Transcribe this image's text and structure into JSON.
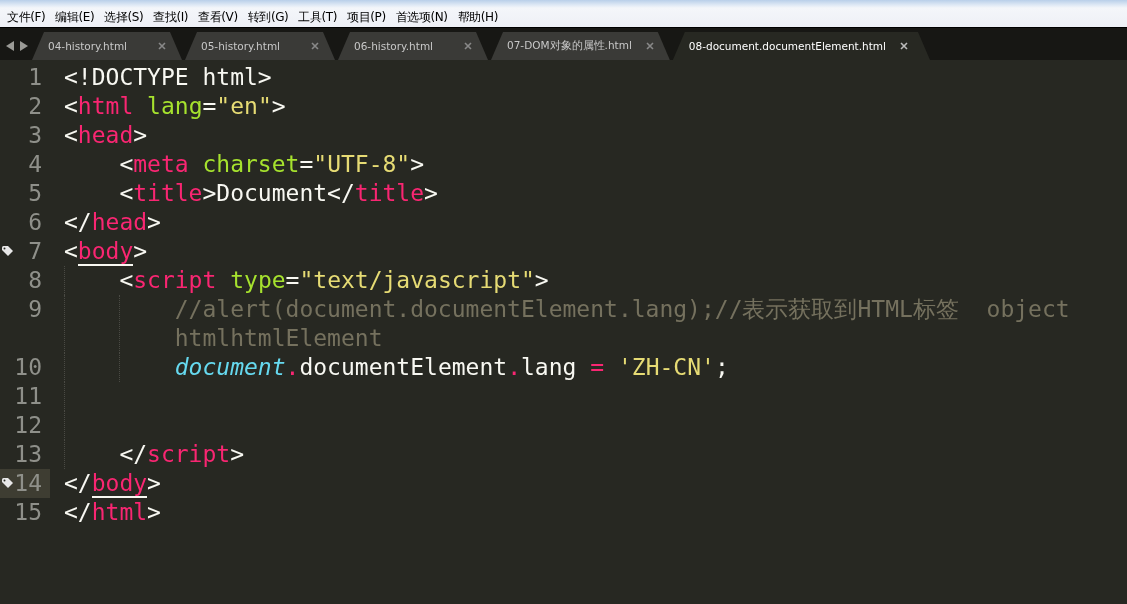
{
  "menu": [
    "文件(F)",
    "编辑(E)",
    "选择(S)",
    "查找(I)",
    "查看(V)",
    "转到(G)",
    "工具(T)",
    "项目(P)",
    "首选项(N)",
    "帮助(H)"
  ],
  "tabs": [
    {
      "label": "04-history.html",
      "selected": false
    },
    {
      "label": "05-history.html",
      "selected": false
    },
    {
      "label": "06-history.html",
      "selected": false
    },
    {
      "label": "07-DOM对象的属性.html",
      "selected": false
    },
    {
      "label": "08-document.documentElement.html",
      "selected": true
    }
  ],
  "lines": [
    {
      "number": "1",
      "bookmark": false,
      "current": false,
      "rows": [
        [
          {
            "text": "<!DOCTYPE html>",
            "kind": "plain"
          }
        ]
      ]
    },
    {
      "number": "2",
      "bookmark": false,
      "current": false,
      "rows": [
        [
          {
            "text": "<",
            "kind": "plain"
          },
          {
            "text": "html",
            "kind": "tag"
          },
          {
            "text": " ",
            "kind": "plain"
          },
          {
            "text": "lang",
            "kind": "attr"
          },
          {
            "text": "=",
            "kind": "plain"
          },
          {
            "text": "\"en\"",
            "kind": "string"
          },
          {
            "text": ">",
            "kind": "plain"
          }
        ]
      ]
    },
    {
      "number": "3",
      "bookmark": false,
      "current": false,
      "rows": [
        [
          {
            "text": "<",
            "kind": "plain"
          },
          {
            "text": "head",
            "kind": "tag"
          },
          {
            "text": ">",
            "kind": "plain"
          }
        ]
      ]
    },
    {
      "number": "4",
      "bookmark": false,
      "current": false,
      "rows": [
        [
          {
            "text": "    <",
            "kind": "plain"
          },
          {
            "text": "meta",
            "kind": "tag"
          },
          {
            "text": " ",
            "kind": "plain"
          },
          {
            "text": "charset",
            "kind": "attr"
          },
          {
            "text": "=",
            "kind": "plain"
          },
          {
            "text": "\"UTF-8\"",
            "kind": "string"
          },
          {
            "text": ">",
            "kind": "plain"
          }
        ]
      ]
    },
    {
      "number": "5",
      "bookmark": false,
      "current": false,
      "rows": [
        [
          {
            "text": "    <",
            "kind": "plain"
          },
          {
            "text": "title",
            "kind": "tag"
          },
          {
            "text": ">Document</",
            "kind": "plain"
          },
          {
            "text": "title",
            "kind": "tag"
          },
          {
            "text": ">",
            "kind": "plain"
          }
        ]
      ]
    },
    {
      "number": "6",
      "bookmark": false,
      "current": false,
      "rows": [
        [
          {
            "text": "</",
            "kind": "plain"
          },
          {
            "text": "head",
            "kind": "tag"
          },
          {
            "text": ">",
            "kind": "plain"
          }
        ]
      ]
    },
    {
      "number": "7",
      "bookmark": true,
      "current": false,
      "rows": [
        [
          {
            "text": "<",
            "kind": "plain"
          },
          {
            "text": "body",
            "kind": "matched-tag"
          },
          {
            "text": ">",
            "kind": "plain"
          }
        ]
      ]
    },
    {
      "number": "8",
      "bookmark": false,
      "current": false,
      "rows": [
        [
          {
            "text": "    <",
            "kind": "plain"
          },
          {
            "text": "script",
            "kind": "tag"
          },
          {
            "text": " ",
            "kind": "plain"
          },
          {
            "text": "type",
            "kind": "attr"
          },
          {
            "text": "=",
            "kind": "plain"
          },
          {
            "text": "\"text/javascript\"",
            "kind": "string"
          },
          {
            "text": ">",
            "kind": "plain"
          }
        ]
      ]
    },
    {
      "number": "9",
      "bookmark": false,
      "current": false,
      "rows": [
        [
          {
            "text": "        //alert(document.documentElement.lang);//表示获取到HTML标签  object",
            "kind": "comment"
          }
        ],
        [
          {
            "text": "        htmlhtmlElement",
            "kind": "comment"
          }
        ]
      ]
    },
    {
      "number": "10",
      "bookmark": false,
      "current": false,
      "rows": [
        [
          {
            "text": "        document",
            "kind": "global"
          },
          {
            "text": ".",
            "kind": "operator"
          },
          {
            "text": "documentElement",
            "kind": "plain"
          },
          {
            "text": ".",
            "kind": "operator"
          },
          {
            "text": "lang ",
            "kind": "plain"
          },
          {
            "text": "=",
            "kind": "operator"
          },
          {
            "text": " ",
            "kind": "plain"
          },
          {
            "text": "'ZH-CN'",
            "kind": "string"
          },
          {
            "text": ";",
            "kind": "plain"
          }
        ]
      ]
    },
    {
      "number": "11",
      "bookmark": false,
      "current": false,
      "rows": [
        []
      ]
    },
    {
      "number": "12",
      "bookmark": false,
      "current": false,
      "rows": [
        []
      ]
    },
    {
      "number": "13",
      "bookmark": false,
      "current": false,
      "rows": [
        [
          {
            "text": "    </",
            "kind": "plain"
          },
          {
            "text": "script",
            "kind": "tag"
          },
          {
            "text": ">",
            "kind": "plain"
          }
        ]
      ]
    },
    {
      "number": "14",
      "bookmark": true,
      "current": true,
      "rows": [
        [
          {
            "text": "</",
            "kind": "plain"
          },
          {
            "text": "body",
            "kind": "matched-tag"
          },
          {
            "text": ">",
            "kind": "plain"
          }
        ]
      ]
    },
    {
      "number": "15",
      "bookmark": false,
      "current": false,
      "rows": [
        [
          {
            "text": "</",
            "kind": "plain"
          },
          {
            "text": "html",
            "kind": "tag"
          },
          {
            "text": ">",
            "kind": "plain"
          }
        ]
      ]
    }
  ]
}
